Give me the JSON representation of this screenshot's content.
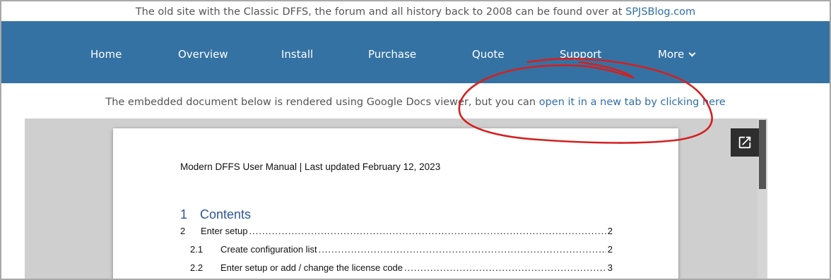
{
  "banner": {
    "text": "The old site with the Classic DFFS, the forum and all history back to 2008 can be found over at ",
    "link": "SPJSBlog.com"
  },
  "nav": {
    "items": [
      {
        "label": "Home"
      },
      {
        "label": "Overview"
      },
      {
        "label": "Install"
      },
      {
        "label": "Purchase"
      },
      {
        "label": "Quote"
      },
      {
        "label": "Support"
      },
      {
        "label": "More"
      }
    ]
  },
  "notice": {
    "text": "The embedded document below is rendered using Google Docs viewer, but you can ",
    "link": "open it in a new tab by clicking here"
  },
  "viewer": {
    "popout_icon": "open-in-new-icon"
  },
  "document": {
    "header": "Modern DFFS User Manual | Last updated February 12, 2023",
    "toc": {
      "title_num": "1",
      "title": "Contents",
      "rows": [
        {
          "num": "2",
          "label": "Enter setup",
          "page": "2"
        },
        {
          "num": "2.1",
          "label": "Create configuration list",
          "page": "2"
        },
        {
          "num": "2.2",
          "label": "Enter setup or add / change the license code",
          "page": "3"
        }
      ]
    }
  },
  "colors": {
    "nav_bg": "#3472a3",
    "link": "#2f6ea6",
    "annotation": "#d42020",
    "toc_heading": "#2f5597"
  }
}
